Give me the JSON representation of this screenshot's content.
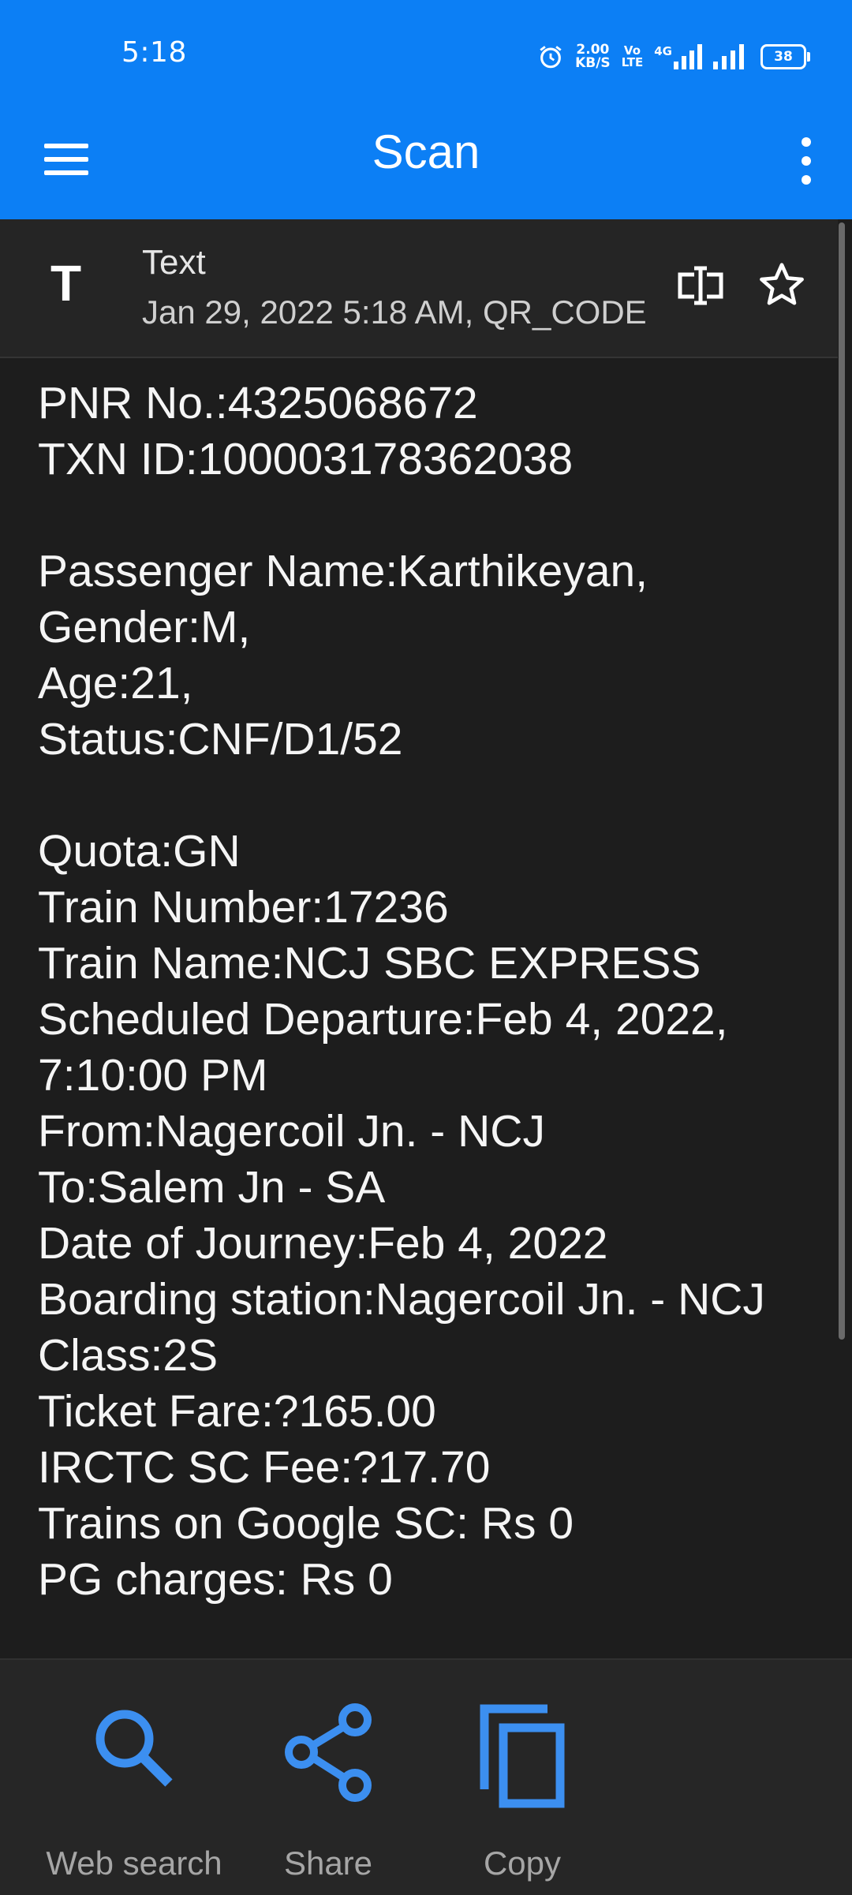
{
  "status_bar": {
    "time": "5:18",
    "speed_value": "2.00",
    "speed_unit": "KB/S",
    "volte_top": "Vo",
    "volte_bottom": "LTE",
    "network": "4G",
    "battery": "38",
    "icons": [
      "alarm-icon",
      "signal-icon",
      "signal-icon",
      "battery-icon"
    ]
  },
  "app_bar": {
    "title": "Scan",
    "icons": [
      "menu-icon",
      "more-vert-icon"
    ]
  },
  "result_header": {
    "type_glyph": "T",
    "type_label": "Text",
    "meta": "Jan 29, 2022 5:18 AM, QR_CODE",
    "icons": [
      "text-select-icon",
      "star-icon"
    ]
  },
  "content": {
    "lines": [
      "PNR No.:4325068672",
      "TXN ID:100003178362038",
      "",
      "Passenger Name:Karthikeyan,",
      "Gender:M,",
      "Age:21,",
      "Status:CNF/D1/52",
      "",
      "Quota:GN",
      "Train Number:17236",
      "Train Name:NCJ SBC EXPRESS",
      "Scheduled Departure:Feb 4, 2022,",
      "7:10:00 PM",
      "From:Nagercoil Jn. - NCJ",
      "To:Salem Jn - SA",
      "Date of Journey:Feb 4, 2022",
      "Boarding station:Nagercoil Jn. - NCJ",
      "Class:2S",
      "Ticket Fare:?165.00",
      "IRCTC SC Fee:?17.70",
      "Trains on Google SC: Rs 0",
      "PG charges: Rs 0"
    ]
  },
  "actions": [
    {
      "label": "Web search",
      "icon": "search-icon"
    },
    {
      "label": "Share",
      "icon": "share-icon"
    },
    {
      "label": "Copy",
      "icon": "copy-icon"
    }
  ],
  "colors": {
    "accent": "#0c7ff5",
    "icon_blue": "#3c8ff0",
    "background": "#1d1d1d"
  }
}
